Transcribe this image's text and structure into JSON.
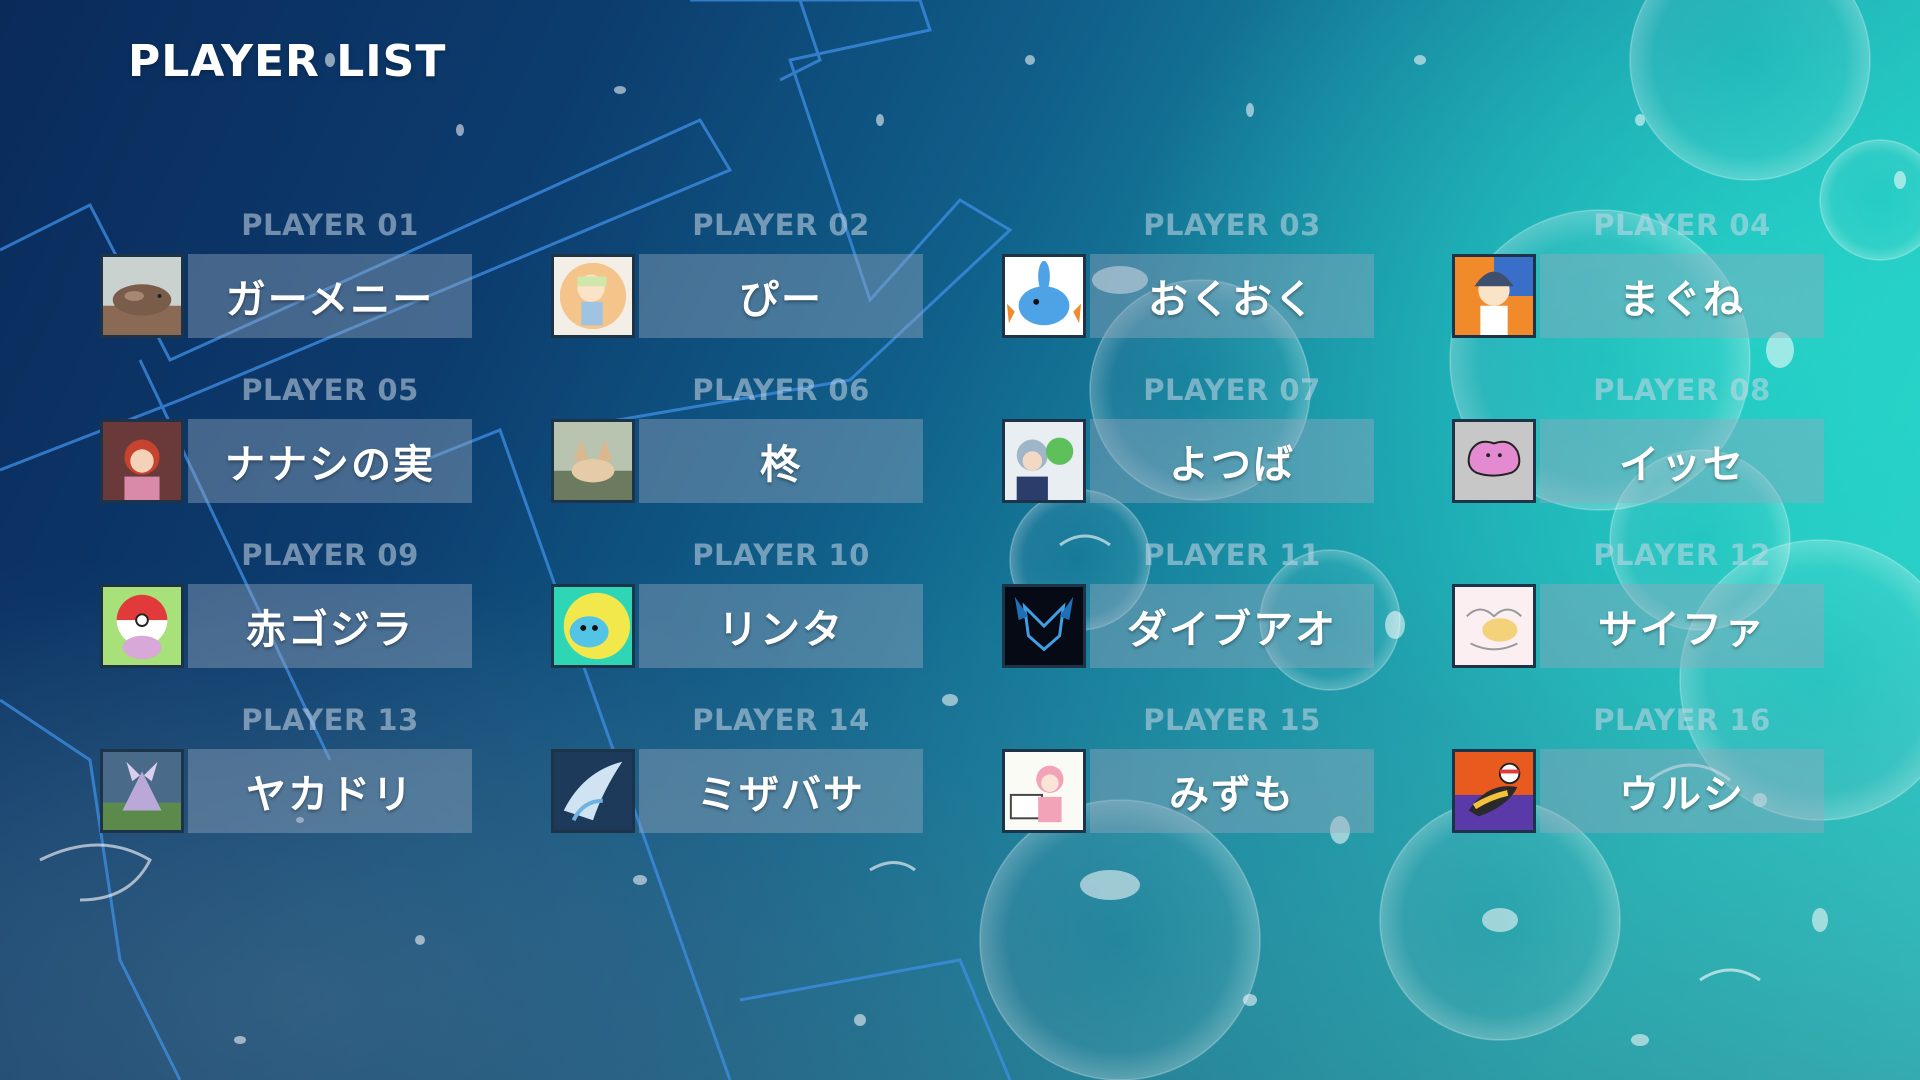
{
  "page": {
    "title": "PLAYER LIST"
  },
  "colors": {
    "plate": "#96aabe",
    "avatar_border": "#1d3348",
    "accent_line": "#3f8fe6"
  },
  "players": [
    {
      "number": "PLAYER 01",
      "name": "ガーメニー",
      "avatar_icon": "avatar-creature-icon"
    },
    {
      "number": "PLAYER 02",
      "name": "ぴー",
      "avatar_icon": "avatar-girl-icon"
    },
    {
      "number": "PLAYER 03",
      "name": "おくおく",
      "avatar_icon": "avatar-mudkip-icon"
    },
    {
      "number": "PLAYER 04",
      "name": "まぐね",
      "avatar_icon": "avatar-character-icon"
    },
    {
      "number": "PLAYER 05",
      "name": "ナナシの実",
      "avatar_icon": "avatar-character-icon"
    },
    {
      "number": "PLAYER 06",
      "name": "柊",
      "avatar_icon": "avatar-fox-icon"
    },
    {
      "number": "PLAYER 07",
      "name": "よつば",
      "avatar_icon": "avatar-character-icon"
    },
    {
      "number": "PLAYER 08",
      "name": "イッセ",
      "avatar_icon": "avatar-ditto-icon"
    },
    {
      "number": "PLAYER 09",
      "name": "赤ゴジラ",
      "avatar_icon": "avatar-pokeball-icon"
    },
    {
      "number": "PLAYER 10",
      "name": "リンタ",
      "avatar_icon": "avatar-blob-icon"
    },
    {
      "number": "PLAYER 11",
      "name": "ダイブアオ",
      "avatar_icon": "avatar-glaceon-icon"
    },
    {
      "number": "PLAYER 12",
      "name": "サイファ",
      "avatar_icon": "avatar-sketch-icon"
    },
    {
      "number": "PLAYER 13",
      "name": "ヤカドリ",
      "avatar_icon": "avatar-battle-icon"
    },
    {
      "number": "PLAYER 14",
      "name": "ミザバサ",
      "avatar_icon": "avatar-dragon-icon"
    },
    {
      "number": "PLAYER 15",
      "name": "みずも",
      "avatar_icon": "avatar-drawing-icon"
    },
    {
      "number": "PLAYER 16",
      "name": "ウルシ",
      "avatar_icon": "avatar-bird-icon"
    }
  ]
}
